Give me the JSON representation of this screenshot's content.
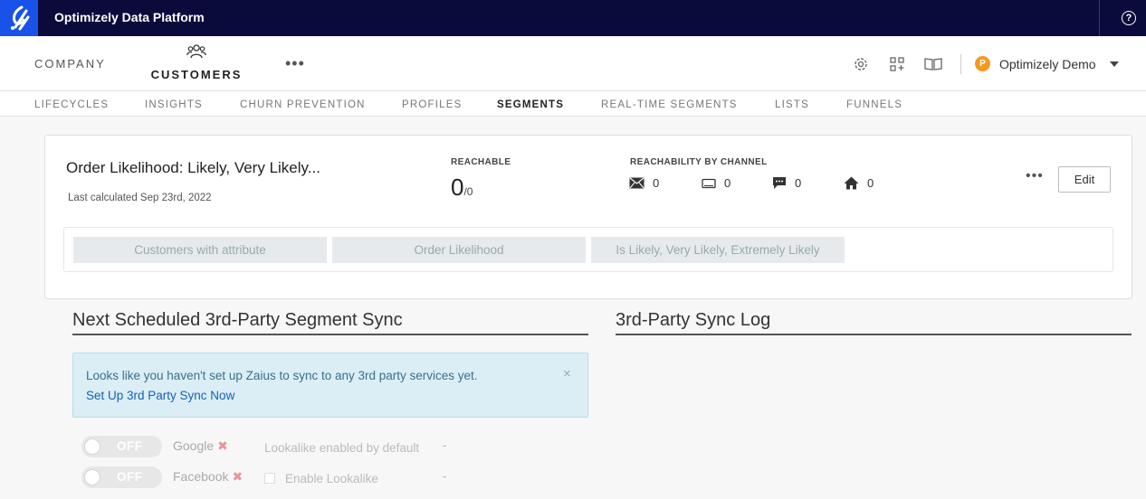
{
  "topbar": {
    "title": "Optimizely Data Platform",
    "help_glyph": "?"
  },
  "mainnav": {
    "company": "COMPANY",
    "customers": "CUSTOMERS",
    "more": "•••",
    "account_initial": "P",
    "account_name": "Optimizely Demo"
  },
  "subnav": [
    {
      "label": "LIFECYCLES",
      "active": false
    },
    {
      "label": "INSIGHTS",
      "active": false
    },
    {
      "label": "CHURN PREVENTION",
      "active": false
    },
    {
      "label": "PROFILES",
      "active": false
    },
    {
      "label": "SEGMENTS",
      "active": true
    },
    {
      "label": "REAL-TIME SEGMENTS",
      "active": false
    },
    {
      "label": "LISTS",
      "active": false
    },
    {
      "label": "FUNNELS",
      "active": false
    }
  ],
  "segment": {
    "title": "Order Likelihood: Likely, Very Likely...",
    "last_calculated": "Last calculated Sep 23rd, 2022",
    "reachable_heading": "REACHABLE",
    "reachable_value": "0",
    "reachable_total": "/0",
    "channel_heading": "REACHABILITY BY CHANNEL",
    "channels": [
      {
        "icon": "email-icon",
        "value": "0"
      },
      {
        "icon": "push-icon",
        "value": "0"
      },
      {
        "icon": "sms-icon",
        "value": "0"
      },
      {
        "icon": "home-icon",
        "value": "0"
      }
    ],
    "more": "•••",
    "edit_label": "Edit",
    "criteria": [
      "Customers with attribute",
      "Order Likelihood",
      "Is Likely, Very Likely, Extremely Likely"
    ]
  },
  "sync": {
    "next_title": "Next Scheduled 3rd-Party Segment Sync",
    "log_title": "3rd-Party Sync Log",
    "alert_message": "Looks like you haven't set up Zaius to sync to any 3rd party services yet.",
    "alert_link": "Set Up 3rd Party Sync Now",
    "alert_close": "×",
    "rows": [
      {
        "toggle": "OFF",
        "service": "Google",
        "lookalike": "Lookalike enabled by default",
        "value": "-"
      },
      {
        "toggle": "OFF",
        "service": "Facebook",
        "lookalike": "Enable Lookalike",
        "value": "-"
      }
    ],
    "remove_glyph": "✖"
  },
  "colors": {
    "topbar": "#0b0b3b",
    "logo": "#1852e8",
    "avatar": "#f39b1f",
    "link": "#1560b8"
  }
}
